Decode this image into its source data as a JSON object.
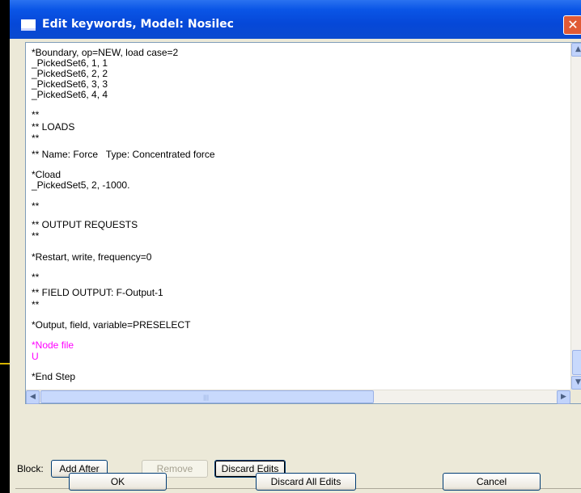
{
  "window": {
    "title": "Edit keywords, Model: Nosilec",
    "close_glyph": "✕"
  },
  "editor": {
    "lines": [
      "*Boundary, op=NEW, load case=2",
      "_PickedSet6, 1, 1",
      "_PickedSet6, 2, 2",
      "_PickedSet6, 3, 3",
      "_PickedSet6, 4, 4",
      "**",
      "** LOADS",
      "**",
      "** Name: Force   Type: Concentrated force",
      "*Cload",
      "_PickedSet5, 2, -1000.",
      "**",
      "** OUTPUT REQUESTS",
      "**",
      "*Restart, write, frequency=0",
      "**",
      "** FIELD OUTPUT: F-Output-1",
      "**",
      "*Output, field, variable=PRESELECT",
      "*Node file",
      "U",
      "*End Step"
    ],
    "highlight_color": "#ff00ff"
  },
  "block": {
    "label": "Block:",
    "add_after": "Add After",
    "remove": "Remove",
    "discard_edits": "Discard Edits"
  },
  "footer": {
    "ok": "OK",
    "discard_all": "Discard All Edits",
    "cancel": "Cancel"
  }
}
